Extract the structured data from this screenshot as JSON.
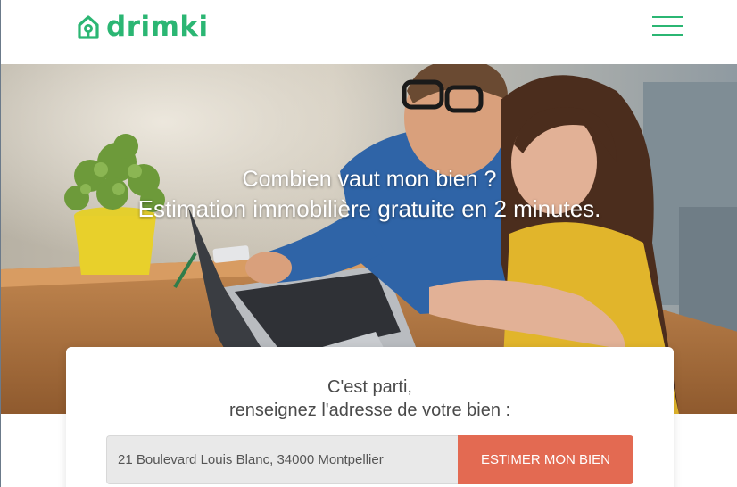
{
  "header": {
    "logo_text": "drimki",
    "brand_color": "#2bb673",
    "logo_icon": "house-icon",
    "menu_icon": "hamburger-menu-icon"
  },
  "hero": {
    "subtitle": "Combien vaut mon bien ?",
    "title": "Estimation immobilière gratuite en 2 minutes.",
    "background": "photo of a couple using a laptop at a wooden table"
  },
  "form": {
    "heading_line1": "C'est parti,",
    "heading_line2": "renseignez l'adresse de votre bien :",
    "address_value": "21 Boulevard Louis Blanc, 34000 Montpellier",
    "submit_label": "ESTIMER MON BIEN",
    "button_color": "#e36a52"
  }
}
